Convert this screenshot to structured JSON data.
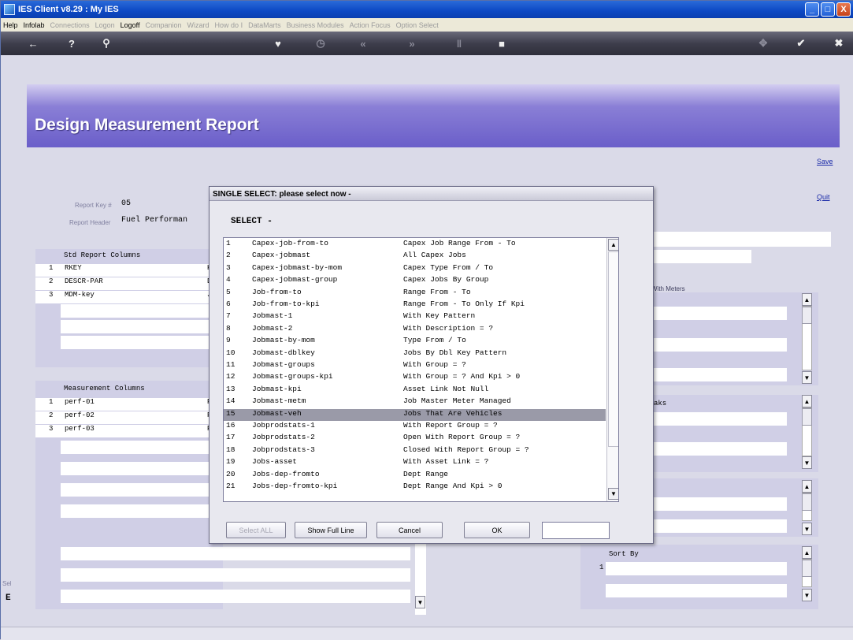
{
  "window": {
    "title": "IES Client v8.29 : My IES",
    "buttons": [
      "_",
      "□",
      "X"
    ]
  },
  "menubar": {
    "items": [
      {
        "label": "Help",
        "active": true
      },
      {
        "label": "Infolab",
        "active": true
      },
      {
        "label": "Connections",
        "active": false
      },
      {
        "label": "Logon",
        "active": false
      },
      {
        "label": "Logoff",
        "active": true
      },
      {
        "label": "Companion",
        "active": false
      },
      {
        "label": "Wizard",
        "active": false
      },
      {
        "label": "How do I",
        "active": false
      },
      {
        "label": "DataMarts",
        "active": false
      },
      {
        "label": "Business Modules",
        "active": false
      },
      {
        "label": "Action Focus",
        "active": false
      },
      {
        "label": "Option Select",
        "active": false
      }
    ]
  },
  "toolbar": {
    "icons": [
      "back-arrow-icon",
      "help-icon",
      "search-icon",
      "heart-icon",
      "clock-icon",
      "rewind-icon",
      "forward-icon",
      "pause-icon",
      "stop-icon",
      "expand-icon",
      "check-icon",
      "close-icon"
    ]
  },
  "page": {
    "title": "Design Measurement Report",
    "save_link": "Save",
    "quit_link": "Quit",
    "report_key_label": "Report Key #",
    "report_key_value": "05",
    "report_header_label": "Report Header",
    "report_header_value": "Fuel Performan",
    "with_meters_text": "With Meters",
    "std_columns_header": "Std Report Columns",
    "std_columns": [
      {
        "n": "1",
        "name": "RKEY",
        "extra": "K"
      },
      {
        "n": "2",
        "name": "DESCR-PAR",
        "extra": "D"
      },
      {
        "n": "3",
        "name": "MDM-key",
        "extra": "J"
      }
    ],
    "measurement_header": "Measurement Columns",
    "measurement_columns": [
      {
        "n": "1",
        "name": "perf-01",
        "extra": "P"
      },
      {
        "n": "2",
        "name": "perf-02",
        "extra": "P"
      },
      {
        "n": "3",
        "name": "perf-03",
        "extra": "P"
      }
    ],
    "breaks_label": "aks",
    "sort_by_label": "Sort By",
    "sort_by_first": "1",
    "footer_left_1": "Sel",
    "footer_left_2": "E"
  },
  "dialog": {
    "title": "SINGLE SELECT: please select now -",
    "prompt": "SELECT -",
    "selected_index": 14,
    "items": [
      {
        "n": "1",
        "key": "Capex-job-from-to",
        "desc": "Capex Job Range From - To"
      },
      {
        "n": "2",
        "key": "Capex-jobmast",
        "desc": "All Capex Jobs"
      },
      {
        "n": "3",
        "key": "Capex-jobmast-by-mom",
        "desc": "Capex Type From / To"
      },
      {
        "n": "4",
        "key": "Capex-jobmast-group",
        "desc": "Capex Jobs By Group"
      },
      {
        "n": "5",
        "key": "Job-from-to",
        "desc": "Range From - To"
      },
      {
        "n": "6",
        "key": "Job-from-to-kpi",
        "desc": "Range From - To Only If Kpi"
      },
      {
        "n": "7",
        "key": "Jobmast-1",
        "desc": "With Key Pattern"
      },
      {
        "n": "8",
        "key": "Jobmast-2",
        "desc": "With Description = ?"
      },
      {
        "n": "9",
        "key": "Jobmast-by-mom",
        "desc": "Type From / To"
      },
      {
        "n": "10",
        "key": "Jobmast-dblkey",
        "desc": "Jobs By Dbl Key Pattern"
      },
      {
        "n": "11",
        "key": "Jobmast-groups",
        "desc": "With Group = ?"
      },
      {
        "n": "12",
        "key": "Jobmast-groups-kpi",
        "desc": "With Group = ? And Kpi > 0"
      },
      {
        "n": "13",
        "key": "Jobmast-kpi",
        "desc": "Asset Link Not Null"
      },
      {
        "n": "14",
        "key": "Jobmast-metm",
        "desc": "Job Master Meter Managed"
      },
      {
        "n": "15",
        "key": "Jobmast-veh",
        "desc": "Jobs That Are Vehicles"
      },
      {
        "n": "16",
        "key": "Jobprodstats-1",
        "desc": "With Report Group = ?"
      },
      {
        "n": "17",
        "key": "Jobprodstats-2",
        "desc": "Open With Report Group = ?"
      },
      {
        "n": "18",
        "key": "Jobprodstats-3",
        "desc": "Closed With Report Group = ?"
      },
      {
        "n": "19",
        "key": "Jobs-asset",
        "desc": "With Asset Link = ?"
      },
      {
        "n": "20",
        "key": "Jobs-dep-fromto",
        "desc": "Dept Range"
      },
      {
        "n": "21",
        "key": "Jobs-dep-fromto-kpi",
        "desc": "Dept Range And Kpi > 0"
      }
    ],
    "buttons": {
      "select_all": "Select ALL",
      "show_full_line": "Show Full Line",
      "cancel": "Cancel",
      "ok": "OK"
    },
    "input_value": ""
  }
}
